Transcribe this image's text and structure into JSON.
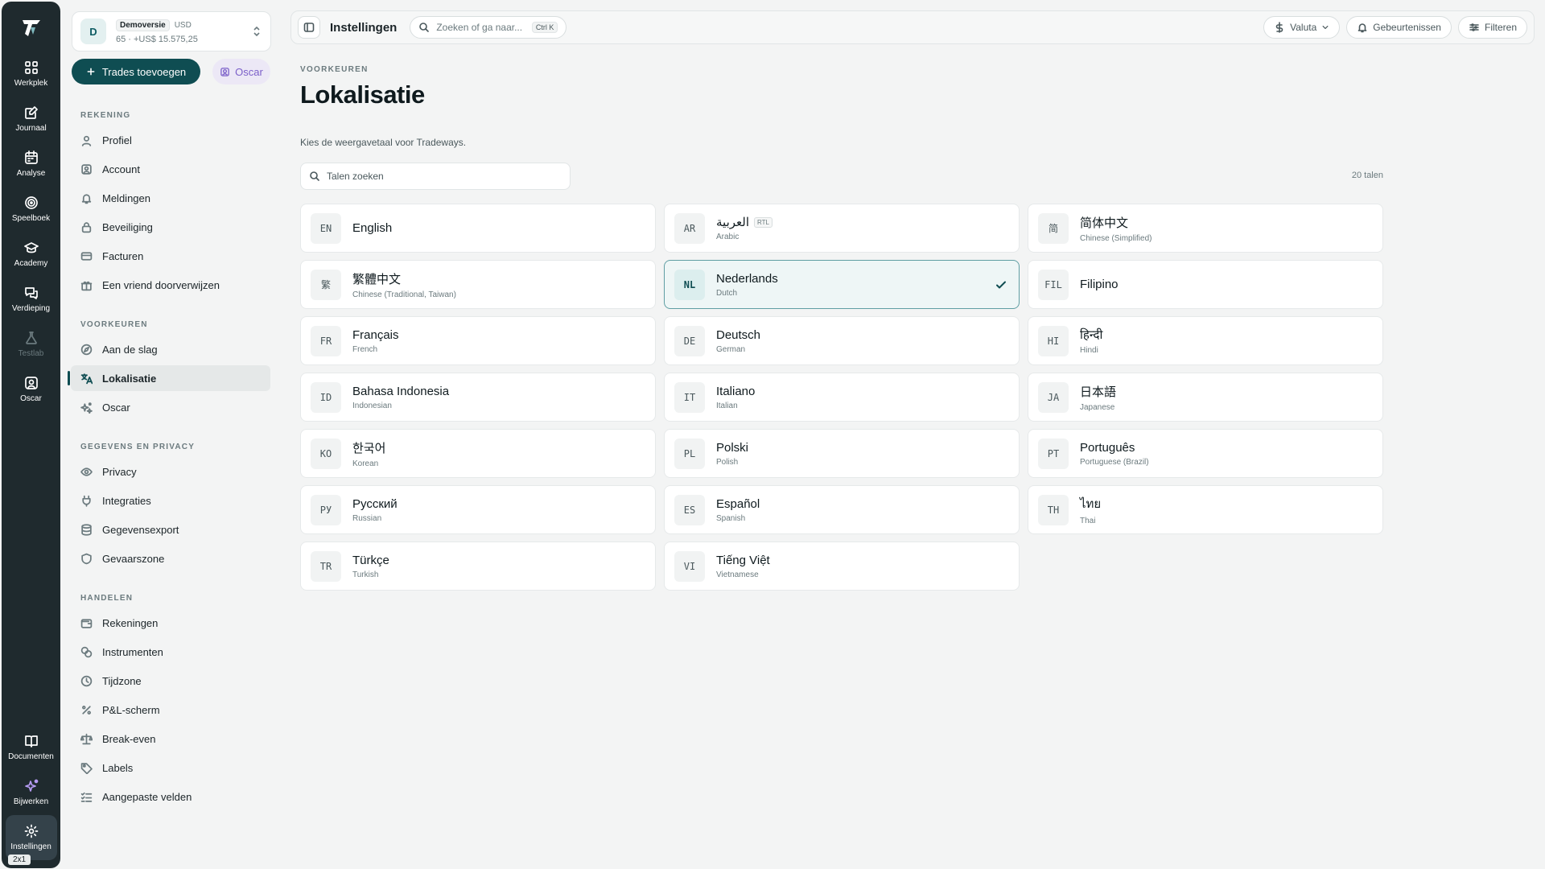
{
  "rail": {
    "items": [
      {
        "label": "Werkplek",
        "icon": "grid-icon"
      },
      {
        "label": "Journaal",
        "icon": "journal-icon"
      },
      {
        "label": "Analyse",
        "icon": "calendar-icon"
      },
      {
        "label": "Speelboek",
        "icon": "target-icon"
      },
      {
        "label": "Academy",
        "icon": "graduation-cap-icon"
      },
      {
        "label": "Verdieping",
        "icon": "chat-icon"
      },
      {
        "label": "Testlab",
        "icon": "flask-icon"
      },
      {
        "label": "Oscar",
        "icon": "oscar-icon"
      }
    ],
    "bottom": [
      {
        "label": "Documenten",
        "icon": "book-icon"
      },
      {
        "label": "Bijwerken",
        "icon": "sparkle-icon"
      },
      {
        "label": "Instellingen",
        "icon": "gear-icon"
      }
    ],
    "kbd_badge": "2x1"
  },
  "account": {
    "avatar": "D",
    "name": "Demoversie",
    "currency": "USD",
    "summary": "65 · +US$ 15.575,25"
  },
  "actions": {
    "add_trades": "Trades toevoegen",
    "oscar": "Oscar"
  },
  "sidebar": {
    "sections": [
      {
        "title": "REKENING",
        "items": [
          "Profiel",
          "Account",
          "Meldingen",
          "Beveiliging",
          "Facturen",
          "Een vriend doorverwijzen"
        ]
      },
      {
        "title": "VOORKEUREN",
        "items": [
          "Aan de slag",
          "Lokalisatie",
          "Oscar"
        ]
      },
      {
        "title": "GEGEVENS EN PRIVACY",
        "items": [
          "Privacy",
          "Integraties",
          "Gegevensexport",
          "Gevaarszone"
        ]
      },
      {
        "title": "HANDELEN",
        "items": [
          "Rekeningen",
          "Instrumenten",
          "Tijdzone",
          "P&L-scherm",
          "Break-even",
          "Labels",
          "Aangepaste velden"
        ]
      }
    ]
  },
  "topbar": {
    "title": "Instellingen",
    "search_placeholder": "Zoeken of ga naar...",
    "search_kbd": "Ctrl K",
    "currency_btn": "Valuta",
    "events_btn": "Gebeurtenissen",
    "filter_btn": "Filteren"
  },
  "page": {
    "eyebrow": "VOORKEUREN",
    "title": "Lokalisatie",
    "description": "Kies de weergavetaal voor Tradeways.",
    "search_placeholder": "Talen zoeken",
    "count": "20 talen",
    "selected_code": "NL",
    "accent_color": "#0f4d52"
  },
  "languages": [
    {
      "code": "EN",
      "native": "English",
      "english": ""
    },
    {
      "code": "AR",
      "native": "العربية",
      "english": "Arabic",
      "badge": "RTL"
    },
    {
      "code": "简",
      "native": "简体中文",
      "english": "Chinese (Simplified)"
    },
    {
      "code": "繁",
      "native": "繁體中文",
      "english": "Chinese (Traditional, Taiwan)"
    },
    {
      "code": "NL",
      "native": "Nederlands",
      "english": "Dutch"
    },
    {
      "code": "FIL",
      "native": "Filipino",
      "english": ""
    },
    {
      "code": "FR",
      "native": "Français",
      "english": "French"
    },
    {
      "code": "DE",
      "native": "Deutsch",
      "english": "German"
    },
    {
      "code": "HI",
      "native": "हिन्दी",
      "english": "Hindi"
    },
    {
      "code": "ID",
      "native": "Bahasa Indonesia",
      "english": "Indonesian"
    },
    {
      "code": "IT",
      "native": "Italiano",
      "english": "Italian"
    },
    {
      "code": "JA",
      "native": "日本語",
      "english": "Japanese"
    },
    {
      "code": "KO",
      "native": "한국어",
      "english": "Korean"
    },
    {
      "code": "PL",
      "native": "Polski",
      "english": "Polish"
    },
    {
      "code": "PT",
      "native": "Português",
      "english": "Portuguese (Brazil)"
    },
    {
      "code": "РУ",
      "native": "Русский",
      "english": "Russian"
    },
    {
      "code": "ES",
      "native": "Español",
      "english": "Spanish"
    },
    {
      "code": "TH",
      "native": "ไทย",
      "english": "Thai"
    },
    {
      "code": "TR",
      "native": "Türkçe",
      "english": "Turkish"
    },
    {
      "code": "VI",
      "native": "Tiếng Việt",
      "english": "Vietnamese"
    }
  ]
}
